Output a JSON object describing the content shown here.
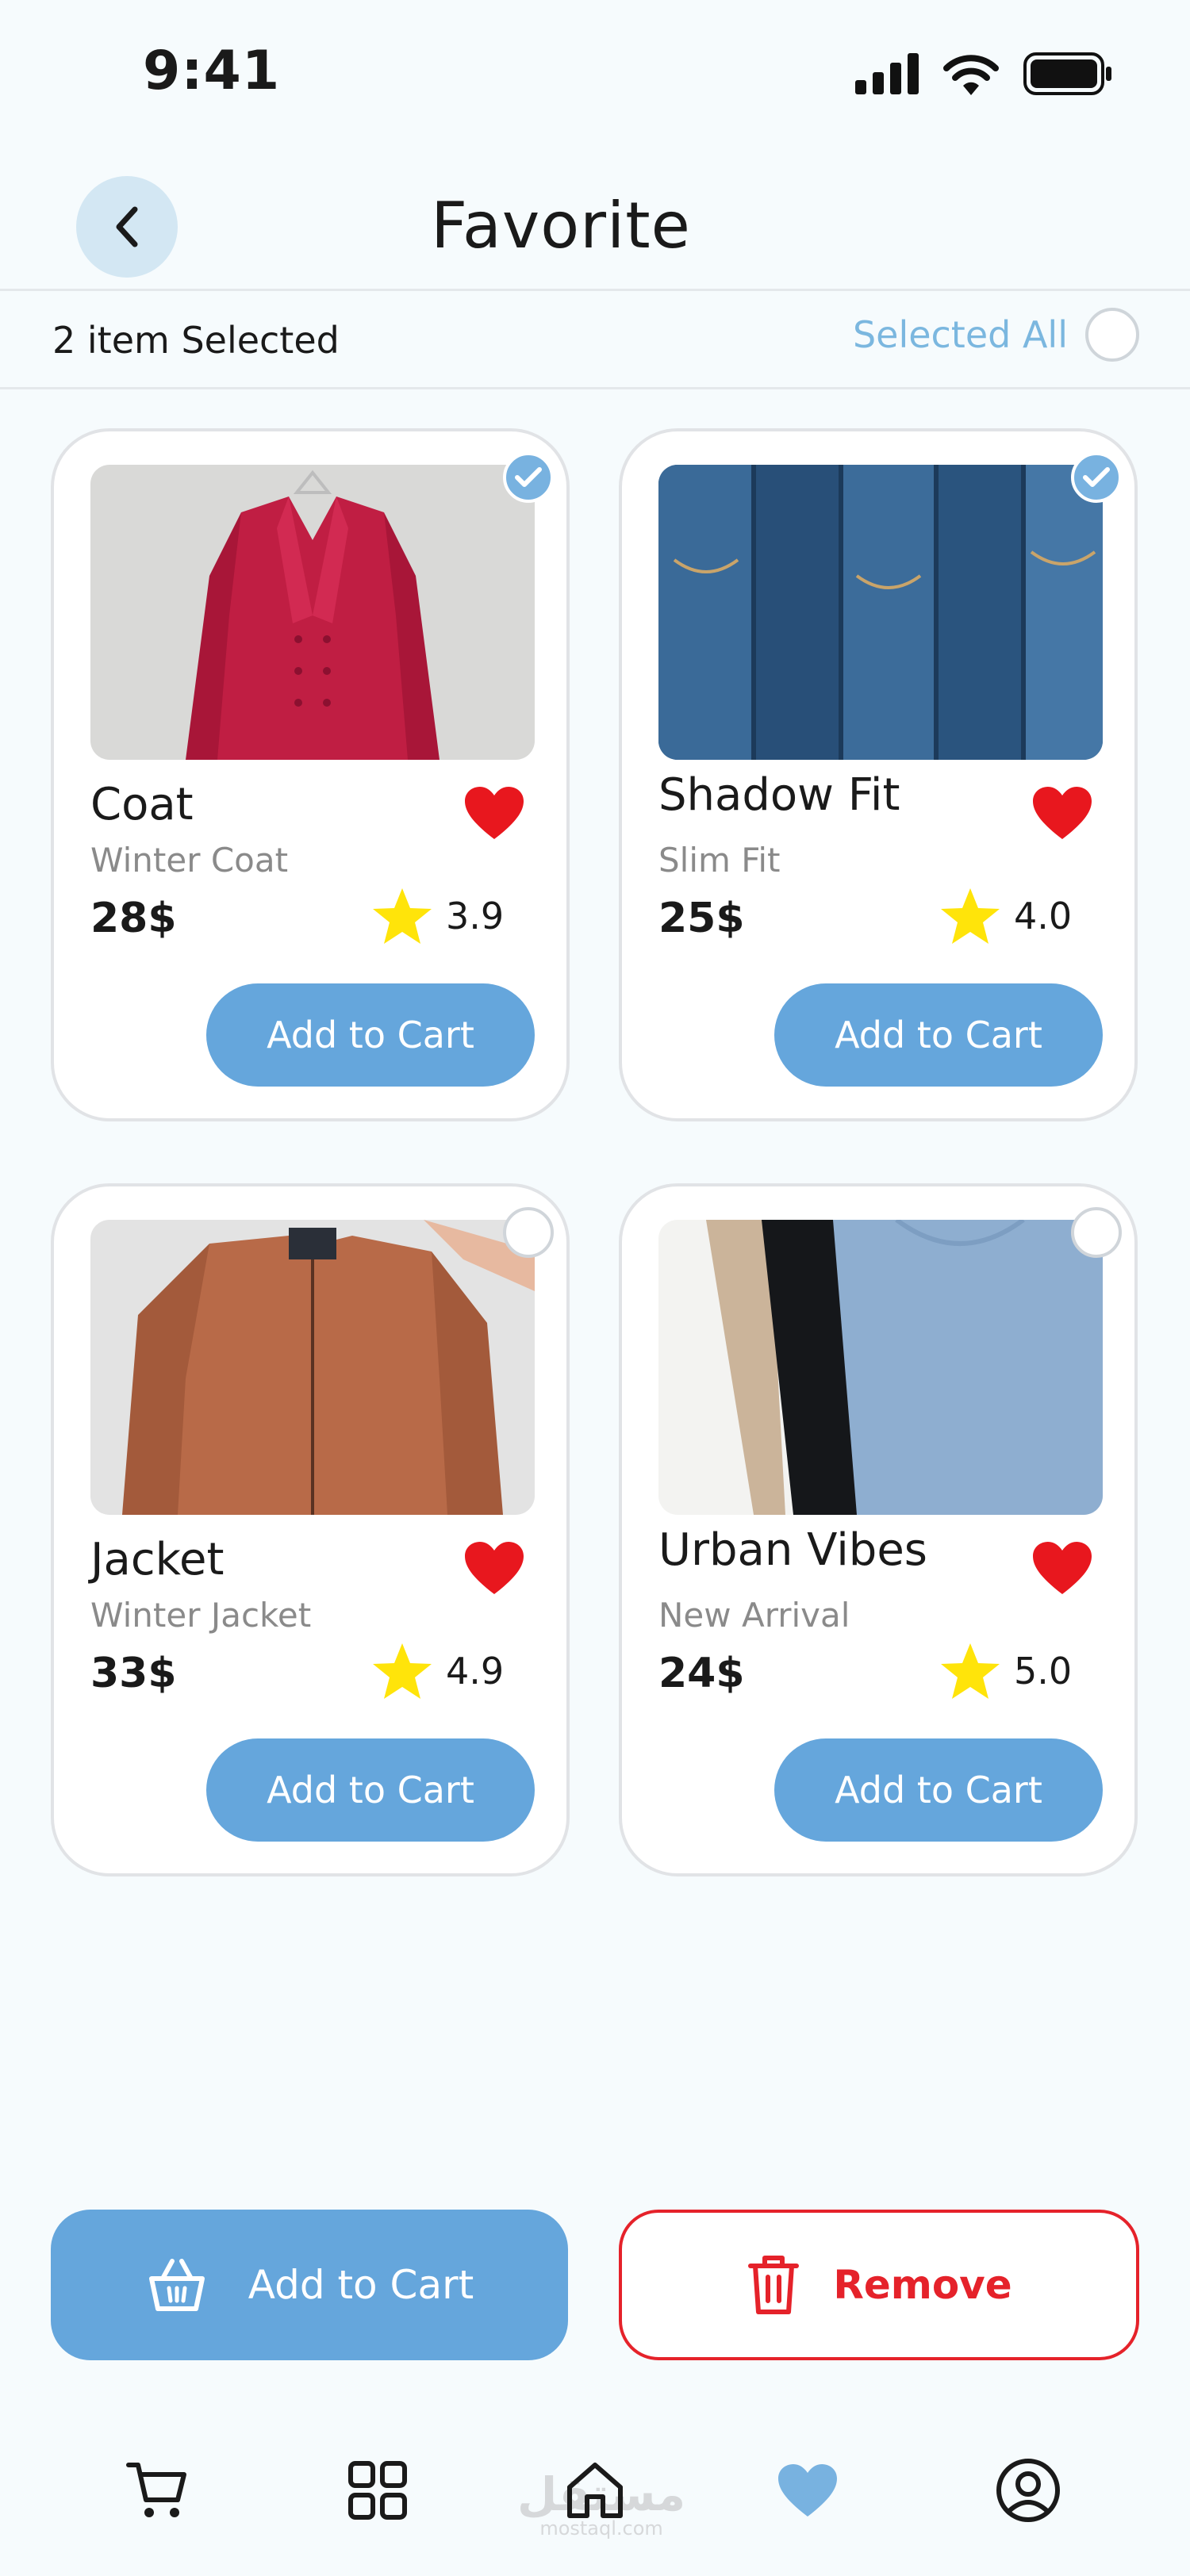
{
  "status_bar": {
    "time": "9:41"
  },
  "header": {
    "title": "Favorite"
  },
  "selection": {
    "count_text": "2 item Selected",
    "select_all_label": "Selected All"
  },
  "products": [
    {
      "name": "Coat",
      "subtitle": "Winter Coat",
      "price": "28$",
      "rating": "3.9",
      "button": "Add to Cart",
      "selected": true,
      "favorite": true
    },
    {
      "name": "Shadow Fit",
      "subtitle": "Slim Fit",
      "price": "25$",
      "rating": "4.0",
      "button": "Add to Cart",
      "selected": true,
      "favorite": true
    },
    {
      "name": "Jacket",
      "subtitle": "Winter Jacket",
      "price": "33$",
      "rating": "4.9",
      "button": "Add to Cart",
      "selected": false,
      "favorite": true
    },
    {
      "name": "Urban Vibes",
      "subtitle": "New Arrival",
      "price": "24$",
      "rating": "5.0",
      "button": "Add to Cart",
      "selected": false,
      "favorite": true
    }
  ],
  "actions": {
    "add_to_cart": "Add to Cart",
    "remove": "Remove"
  },
  "watermark": {
    "arabic": "مستقل",
    "latin": "mostaql.com"
  },
  "nav": [
    {
      "icon": "cart-icon"
    },
    {
      "icon": "grid-icon"
    },
    {
      "icon": "home-icon"
    },
    {
      "icon": "heart-icon",
      "active": true
    },
    {
      "icon": "profile-icon"
    }
  ],
  "colors": {
    "accent": "#65a6dc",
    "danger": "#e5222a",
    "heart": "#e8171e",
    "star": "#ffe40a",
    "check": "#78b2e0"
  }
}
